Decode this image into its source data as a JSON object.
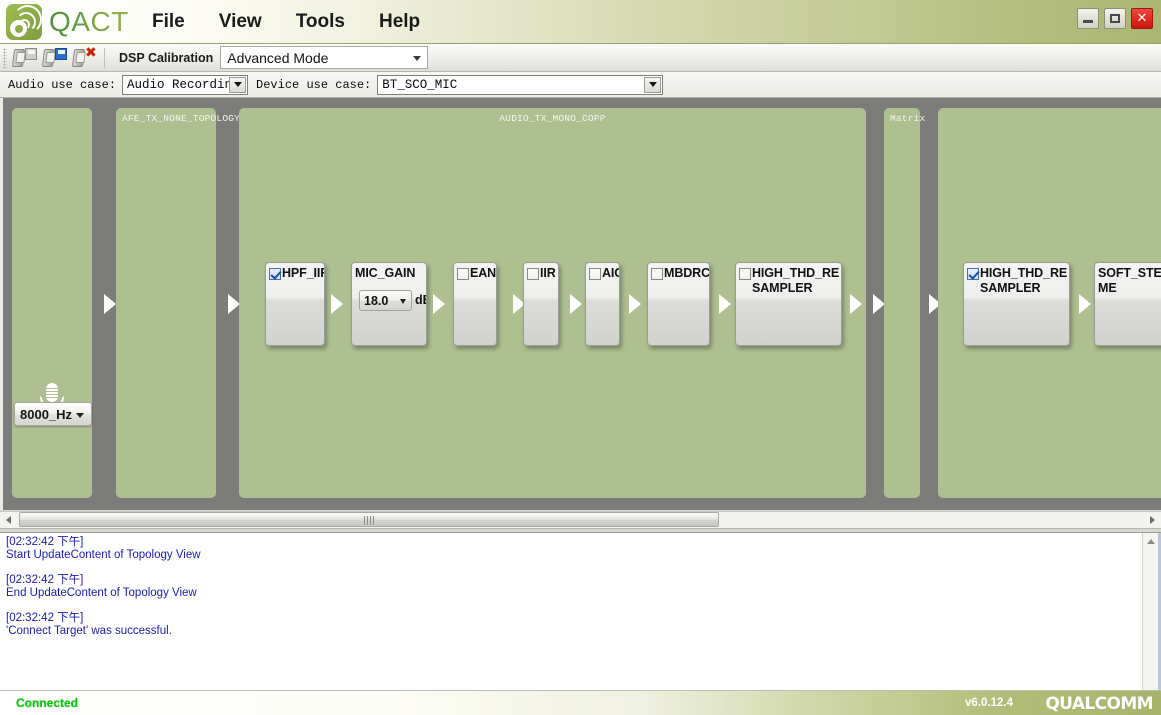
{
  "app": {
    "name": "QACT",
    "logo_icon": "qact-gear-signal-logo"
  },
  "menu": {
    "items": [
      {
        "label": "File"
      },
      {
        "label": "View"
      },
      {
        "label": "Tools"
      },
      {
        "label": "Help"
      }
    ]
  },
  "window_controls": {
    "minimize": {
      "icon": "minimize-icon",
      "glyph": ""
    },
    "maximize": {
      "icon": "maximize-icon",
      "glyph": ""
    },
    "close": {
      "icon": "close-icon",
      "glyph": "✕"
    }
  },
  "toolbar": {
    "icons": [
      {
        "name": "open-device-config-icon",
        "badge": "save-grey"
      },
      {
        "name": "save-device-config-icon",
        "badge": "save-blue"
      },
      {
        "name": "close-device-config-icon",
        "badge": "xmark"
      }
    ],
    "dsp_label": "DSP Calibration",
    "mode_combo": {
      "value": "Advanced Mode",
      "options": [
        "Advanced Mode"
      ]
    }
  },
  "usecase_bar": {
    "audio_label": "Audio use case:",
    "audio_value": "Audio Recording",
    "device_label": "Device use case:",
    "device_value": "BT_SCO_MIC"
  },
  "topology": {
    "source": {
      "icon": "microphone-icon",
      "sample_rate": "8000_Hz"
    },
    "panels": [
      {
        "title": "",
        "id": "source-panel"
      },
      {
        "title": "AFE_TX_NONE_TOPOLOGY",
        "id": "afe-panel"
      },
      {
        "title": "AUDIO_TX_MONO_COPP",
        "id": "copp-panel"
      },
      {
        "title": "Matrix",
        "id": "matrix-panel"
      },
      {
        "title": "",
        "id": "right-panel"
      }
    ],
    "modules": [
      {
        "label": "HPF_IIR",
        "checked": true,
        "has_checkbox": true
      },
      {
        "label": "MIC_GAIN",
        "checked": false,
        "has_checkbox": false,
        "gain_value": "18.0",
        "gain_unit": "dB"
      },
      {
        "label": "EANS",
        "checked": false,
        "has_checkbox": true
      },
      {
        "label": "IIR",
        "checked": false,
        "has_checkbox": true
      },
      {
        "label": "AIG",
        "checked": false,
        "has_checkbox": true
      },
      {
        "label": "MBDRC",
        "checked": false,
        "has_checkbox": true
      },
      {
        "label": "HIGH_THD_RE\nSAMPLER",
        "checked": false,
        "has_checkbox": true
      },
      {
        "label": "HIGH_THD_RE\nSAMPLER",
        "checked": true,
        "has_checkbox": true
      },
      {
        "label": "SOFT_STE\nME",
        "checked": false,
        "has_checkbox": false
      }
    ]
  },
  "log": {
    "entries": [
      {
        "time": "[02:32:42 下午]",
        "message": "Start UpdateContent of Topology View"
      },
      {
        "time": "[02:32:42 下午]",
        "message": "End UpdateContent of Topology View"
      },
      {
        "time": "[02:32:42 下午]",
        "message": "'Connect Target' was successful."
      }
    ]
  },
  "statusbar": {
    "status": "Connected",
    "version": "v6.0.12.4",
    "brand": "QUALCOMM"
  },
  "colors": {
    "panel_green": "#aec091",
    "canvas_grey": "#7c7c78",
    "status_green": "#00cc00",
    "log_blue": "#1b1bbb",
    "close_red": "#e02a20"
  }
}
